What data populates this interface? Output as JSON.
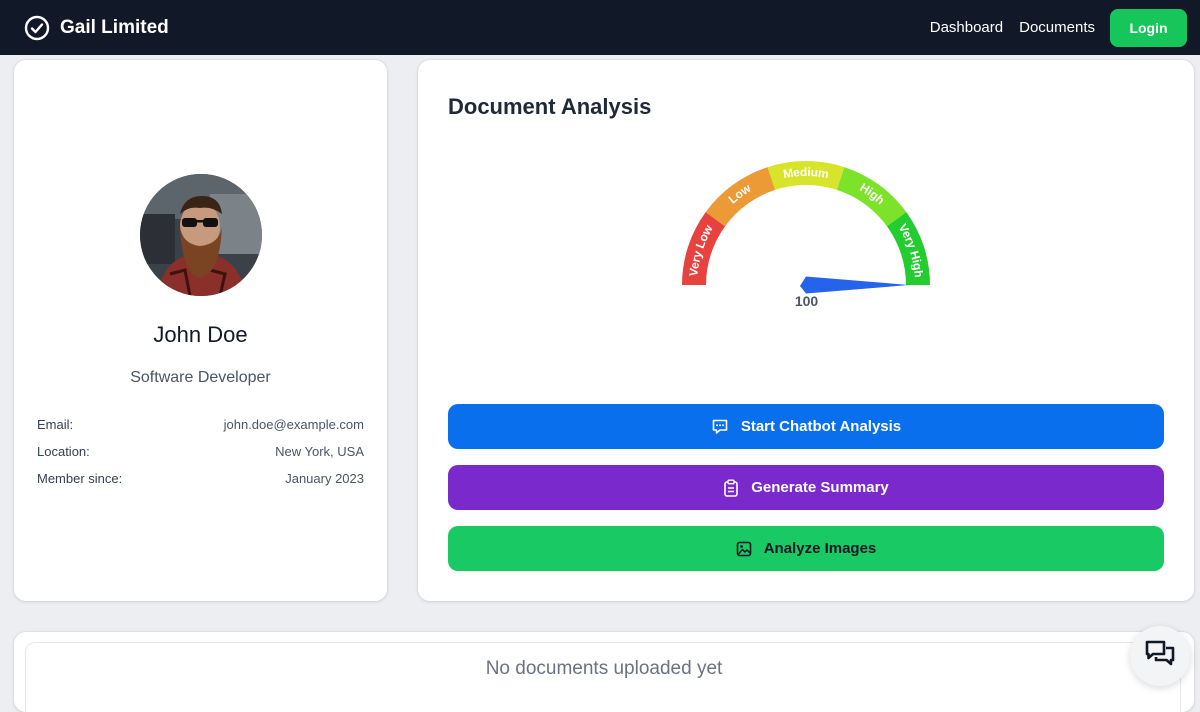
{
  "navbar": {
    "brand_name": "Gail Limited",
    "links": [
      "Dashboard",
      "Documents"
    ],
    "login_label": "Login"
  },
  "profile": {
    "name": "John Doe",
    "role": "Software Developer",
    "details": [
      {
        "label": "Email:",
        "value": "john.doe@example.com"
      },
      {
        "label": "Location:",
        "value": "New York, USA"
      },
      {
        "label": "Member since:",
        "value": "January 2023"
      }
    ]
  },
  "analysis": {
    "title": "Document Analysis",
    "gauge": {
      "value": 100,
      "value_label": "100",
      "min": 0,
      "max": 100,
      "segments": [
        {
          "label": "Very Low",
          "color": "#e8423f"
        },
        {
          "label": "Low",
          "color": "#ec9a35"
        },
        {
          "label": "Medium",
          "color": "#d8e42a"
        },
        {
          "label": "High",
          "color": "#7de32a"
        },
        {
          "label": "Very High",
          "color": "#23cc2f"
        }
      ],
      "needle_color": "#2563eb"
    },
    "buttons": {
      "chatbot": "Start Chatbot Analysis",
      "summary": "Generate Summary",
      "images": "Analyze Images"
    }
  },
  "documents": {
    "empty_text": "No documents uploaded yet"
  },
  "icons": {
    "brand": "check-circle-icon",
    "chatbot": "chat-bubble-icon",
    "summary": "clipboard-icon",
    "images": "image-icon",
    "fab": "chat-bubbles-icon"
  },
  "colors": {
    "navbar": "#111827",
    "login": "#16c65b",
    "chatbot_button": "#0a6fec",
    "summary_button": "#7a29cc",
    "images_button": "#18c964"
  }
}
